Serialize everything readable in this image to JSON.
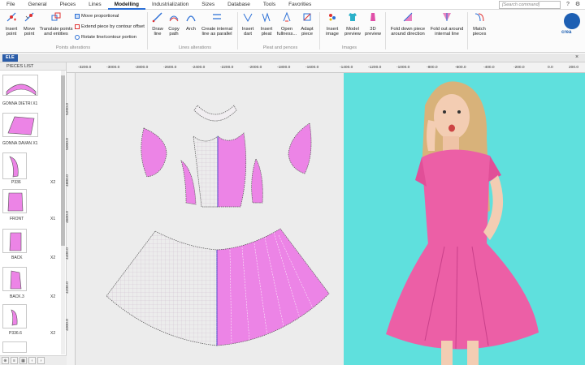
{
  "menu": {
    "items": [
      "File",
      "General",
      "Pieces",
      "Lines",
      "Modelling",
      "Industrialization",
      "Sizes",
      "Database",
      "Tools",
      "Favorities"
    ],
    "active": "Modelling",
    "search_placeholder": "[Search command]",
    "window_controls": [
      "help-icon",
      "settings-icon",
      "close-icon"
    ]
  },
  "ribbon": {
    "insert_point": "Insert point",
    "move_point": "Move point",
    "translate": "Translate points and entities",
    "move_proportional": "Move proportional",
    "extend_piece": "Extend piece by contour offset",
    "rotate_line": "Rotate line/contour portion",
    "draw_line": "Draw line",
    "copy_path": "Copy path",
    "arch": "Arch",
    "create_internal": "Create internal line as parallel",
    "insert_dart": "Insert dart",
    "insert_pleat": "Insert pleat",
    "open_fullness": "Open fullness...",
    "adapt_piece": "Adapt piece",
    "insert_image": "Insert image",
    "model_preview": "Model preview",
    "preview_3d": "3D preview",
    "fold_down": "Fold down piece around direction",
    "fold_out": "Fold out around internal line",
    "match_pieces": "Match pieces",
    "groups": {
      "points": "Points alterations",
      "lines": "Lines alterations",
      "pleat": "Pleat and pences",
      "images": "Images"
    },
    "brand": "crea"
  },
  "tabs": {
    "doc": "ELE"
  },
  "pieces": {
    "title": "PIECES LIST",
    "items": [
      {
        "label": "GONNA DIETRI X1",
        "qty": ""
      },
      {
        "label": "GONNA DAVAN X1",
        "qty": ""
      },
      {
        "label": "P336",
        "qty": "X2"
      },
      {
        "label": "FRONT",
        "qty": "X1"
      },
      {
        "label": "BACK",
        "qty": "X2"
      },
      {
        "label": "BACK.3",
        "qty": "X2"
      },
      {
        "label": "P336.6",
        "qty": "X2"
      }
    ]
  },
  "ruler": {
    "top": [
      "-3200.0",
      "-3000.0",
      "-2800.0",
      "-2600.0",
      "-2400.0",
      "-2200.0",
      "-2000.0",
      "-1800.0",
      "-1600.0",
      "-1400.0",
      "-1200.0",
      "-1000.0",
      "-800.0",
      "-600.0",
      "-400.0",
      "-200.0",
      "0.0",
      "200.0"
    ],
    "left": [
      "5200.0",
      "5000.0",
      "4800.0",
      "4600.0",
      "4400.0",
      "4200.0",
      "4000.0"
    ]
  },
  "colors": {
    "piece_fill": "#ec84e6",
    "piece_light": "#f2e6f2",
    "accent": "#2a5ca8",
    "photo_bg": "#5fe0dd",
    "dress": "#ec5fa6"
  }
}
